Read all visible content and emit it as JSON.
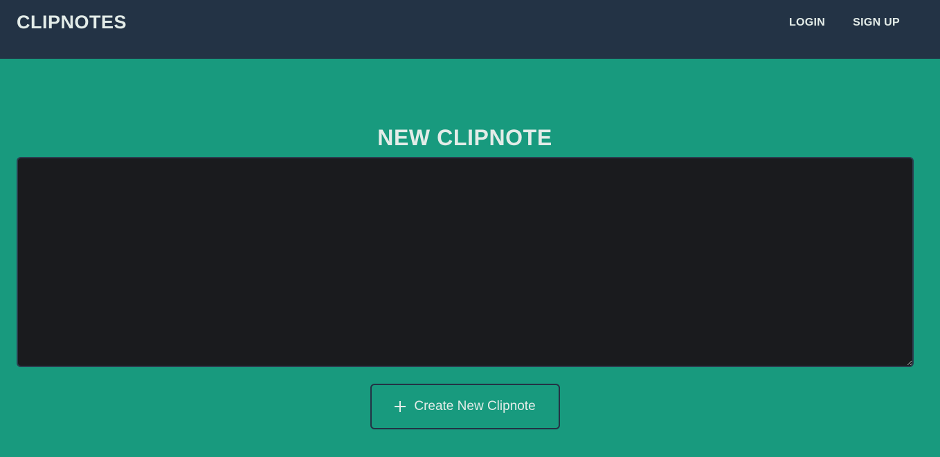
{
  "header": {
    "brand": "CLIPNOTES",
    "links": [
      {
        "label": "LOGIN"
      },
      {
        "label": "SIGN UP"
      }
    ]
  },
  "main": {
    "title": "NEW CLIPNOTE",
    "note_input": {
      "value": "",
      "placeholder": ""
    },
    "create_button": {
      "label": "Create New Clipnote",
      "icon": "plus-icon"
    }
  },
  "colors": {
    "header_bg": "#233345",
    "page_bg": "#189a7e",
    "input_bg": "#1a1b1e",
    "text": "#e3ece8"
  }
}
